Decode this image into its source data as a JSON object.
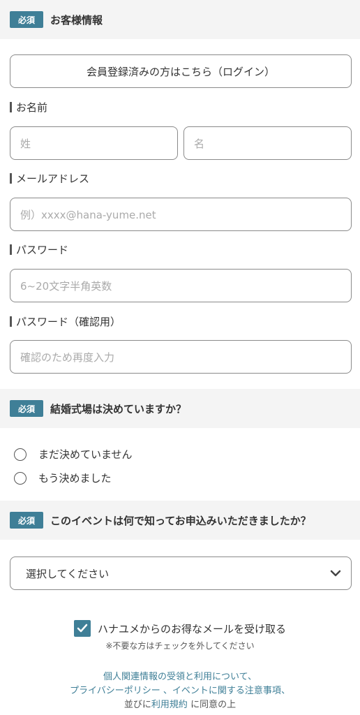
{
  "required_label": "必須",
  "sections": {
    "customer_info": "お客様情報",
    "wedding": "結婚式場は決めていますか？",
    "source": "このイベントは何で知ってお申込みいただきましたか？"
  },
  "login_button": "会員登録済みの方はこちら（ログイン）",
  "fields": {
    "name_label": "お名前",
    "last_name_placeholder": "姓",
    "first_name_placeholder": "名",
    "email_label": "メールアドレス",
    "email_placeholder": "例）xxxx@hana-yume.net",
    "password_label": "パスワード",
    "password_placeholder": "6~20文字半角英数",
    "password_confirm_label": "パスワード（確認用）",
    "password_confirm_placeholder": "確認のため再度入力"
  },
  "wedding_options": [
    "まだ決めていません",
    "もう決めました"
  ],
  "select": {
    "value": "選択してください"
  },
  "newsletter": {
    "label": "ハナユメからのお得なメールを受け取る",
    "checked": true,
    "note": "※不要な方はチェックを外してください"
  },
  "terms": {
    "line1": "個人関連情報の受領と利用について、",
    "line2a": "プライバシーポリシー",
    "line2b": " 、",
    "line2c": "イベントに関する注意事項",
    "line2d": "、",
    "line3a": "並びに",
    "line3b": "利用規約",
    "line3c": " に同意の上"
  },
  "colors": {
    "accent": "#3f7f97",
    "section_bg": "#f4f4f4",
    "border": "#8a8a8a"
  }
}
